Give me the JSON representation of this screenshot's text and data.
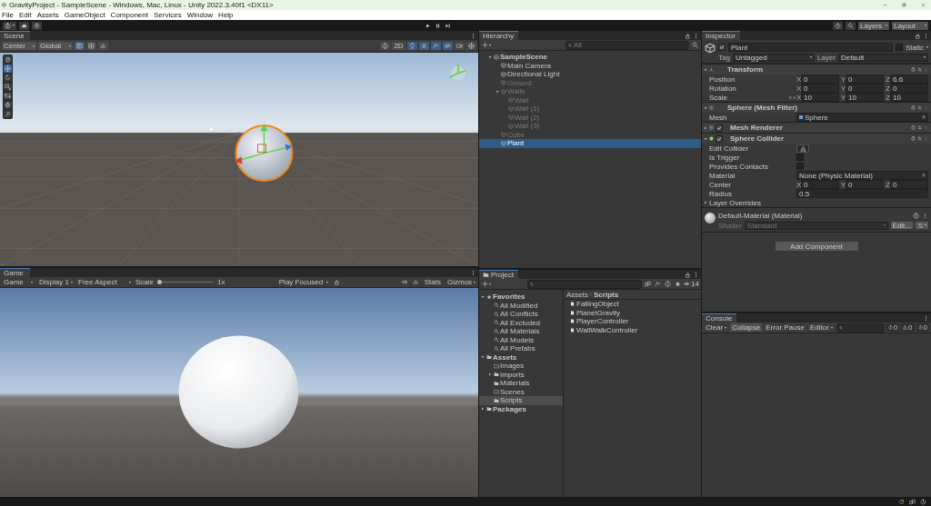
{
  "window": {
    "title": "GravityProject - SampleScene - Windows, Mac, Linux - Unity 2022.3.40f1 <DX11>"
  },
  "menu": [
    "File",
    "Edit",
    "Assets",
    "GameObject",
    "Component",
    "Services",
    "Window",
    "Help"
  ],
  "toolbar": {
    "layers": "Layers",
    "layout": "Layout"
  },
  "scene": {
    "tab": "Scene",
    "pivot": "Center",
    "space": "Global",
    "view_2d": "2D",
    "tools": [
      {
        "kind": "hand",
        "selected": false
      },
      {
        "kind": "move",
        "selected": true
      },
      {
        "kind": "rotate",
        "selected": false
      },
      {
        "kind": "scale",
        "selected": false
      },
      {
        "kind": "rect",
        "selected": false
      },
      {
        "kind": "transform",
        "selected": false
      },
      {
        "kind": "custom",
        "selected": false
      }
    ]
  },
  "game": {
    "tab": "Game",
    "mode": "Game",
    "display": "Display 1",
    "aspect": "Free Aspect",
    "scale_label": "Scale",
    "scale": {
      "level": 0
    },
    "scale_reading": "1x",
    "play_mode": "Play Focused",
    "stats": "Stats",
    "gizmos": "Gizmos"
  },
  "hierarchy": {
    "tab": "Hierarchy",
    "search_placeholder": "All",
    "items": [
      {
        "label": "SampleScene",
        "kind": "scene",
        "active": true,
        "selected": false,
        "expanded": true,
        "children": [
          {
            "label": "Main Camera",
            "kind": "object",
            "active": true,
            "selected": false
          },
          {
            "label": "Directional Light",
            "kind": "object",
            "active": true,
            "selected": false
          },
          {
            "label": "Ground",
            "kind": "object",
            "active": false,
            "selected": false
          },
          {
            "label": "Walls",
            "kind": "object",
            "active": false,
            "selected": false,
            "expanded": true,
            "children": [
              {
                "label": "Wall",
                "kind": "object",
                "active": false,
                "selected": false
              },
              {
                "label": "Wall (1)",
                "kind": "object",
                "active": false,
                "selected": false
              },
              {
                "label": "Wall (2)",
                "kind": "object",
                "active": false,
                "selected": false
              },
              {
                "label": "Wall (3)",
                "kind": "object",
                "active": false,
                "selected": false
              }
            ]
          },
          {
            "label": "Cube",
            "kind": "object",
            "active": false,
            "selected": false
          },
          {
            "label": "Plant",
            "kind": "object",
            "active": true,
            "selected": true
          }
        ]
      }
    ]
  },
  "inspector": {
    "tab": "Inspector",
    "object": {
      "name": "Plant",
      "active": true,
      "static_label": "Static",
      "static": false,
      "tag_label": "Tag",
      "tag": "Untagged",
      "layer_label": "Layer",
      "layer": "Default"
    },
    "components": [
      {
        "kind": "transform",
        "title": "Transform",
        "expanded": true,
        "rows": [
          {
            "kind": "vector",
            "label": "Position",
            "values": [
              {
                "axis": "X",
                "value": "0"
              },
              {
                "axis": "Y",
                "value": "0"
              },
              {
                "axis": "Z",
                "value": "6.6"
              }
            ]
          },
          {
            "kind": "vector",
            "label": "Rotation",
            "values": [
              {
                "axis": "X",
                "value": "0"
              },
              {
                "axis": "Y",
                "value": "0"
              },
              {
                "axis": "Z",
                "value": "0"
              }
            ]
          },
          {
            "kind": "vector",
            "label": "Scale",
            "constrain_proportions": false,
            "values": [
              {
                "axis": "X",
                "value": "10"
              },
              {
                "axis": "Y",
                "value": "10"
              },
              {
                "axis": "Z",
                "value": "10"
              }
            ]
          }
        ]
      },
      {
        "kind": "mesh_filter",
        "title": "Sphere (Mesh Filter)",
        "expanded": true,
        "rows": [
          {
            "kind": "object",
            "label": "Mesh",
            "value": "Sphere"
          }
        ]
      },
      {
        "kind": "mesh_renderer",
        "title": "Mesh Renderer",
        "expanded": false,
        "enabled": true
      },
      {
        "kind": "sphere_collider",
        "title": "Sphere Collider",
        "expanded": true,
        "enabled": true,
        "rows": [
          {
            "kind": "edit",
            "label": "Edit Collider"
          },
          {
            "kind": "checkbox",
            "label": "Is Trigger",
            "checked": false
          },
          {
            "kind": "checkbox",
            "label": "Provides Contacts",
            "checked": false
          },
          {
            "kind": "object",
            "label": "Material",
            "value": "None (Physic Material)"
          },
          {
            "kind": "vector",
            "label": "Center",
            "values": [
              {
                "axis": "X",
                "value": "0"
              },
              {
                "axis": "Y",
                "value": "0"
              },
              {
                "axis": "Z",
                "value": "0"
              }
            ]
          },
          {
            "kind": "float",
            "label": "Radius",
            "value": "0.5"
          },
          {
            "kind": "foldout",
            "label": "Layer Overrides",
            "expanded": false
          }
        ]
      }
    ],
    "material": {
      "name": "Default-Material (Material)",
      "shader_label": "Shader",
      "shader": "Standard",
      "edit": "Edit..."
    },
    "add_component": "Add Component"
  },
  "project": {
    "tab": "Project",
    "count": "14",
    "tree": [
      {
        "label": "Favorites",
        "kind": "favorites",
        "selected": false,
        "expanded": true,
        "children": [
          {
            "label": "All Modified",
            "kind": "search",
            "selected": false
          },
          {
            "label": "All Conflicts",
            "kind": "search",
            "selected": false
          },
          {
            "label": "All Excluded",
            "kind": "search",
            "selected": false
          },
          {
            "label": "All Materials",
            "kind": "search",
            "selected": false
          },
          {
            "label": "All Models",
            "kind": "search",
            "selected": false
          },
          {
            "label": "All Prefabs",
            "kind": "search",
            "selected": false
          }
        ]
      },
      {
        "label": "Assets",
        "kind": "folder",
        "selected": false,
        "expanded": true,
        "children": [
          {
            "label": "Images",
            "kind": "empty_folder",
            "selected": false
          },
          {
            "label": "Imports",
            "kind": "folder",
            "selected": false,
            "expanded": false
          },
          {
            "label": "Materials",
            "kind": "folder",
            "selected": false
          },
          {
            "label": "Scenes",
            "kind": "empty_folder",
            "selected": false
          },
          {
            "label": "Scripts",
            "kind": "folder",
            "selected": true
          }
        ]
      },
      {
        "label": "Packages",
        "kind": "folder",
        "selected": false,
        "expanded": false
      }
    ],
    "breadcrumb": [
      "Assets",
      "Scripts"
    ],
    "files": [
      "FallingObject",
      "PlanetGravity",
      "PlayerController",
      "WallWalkController"
    ]
  },
  "console": {
    "tab": "Console",
    "clear": "Clear",
    "toggles": [
      {
        "label": "Collapse",
        "on": true
      },
      {
        "label": "Error Pause",
        "on": false
      }
    ],
    "editor": "Editor",
    "counts": [
      {
        "kind": "info",
        "value": "0"
      },
      {
        "kind": "warning",
        "value": "0"
      },
      {
        "kind": "error",
        "value": "0"
      }
    ]
  }
}
